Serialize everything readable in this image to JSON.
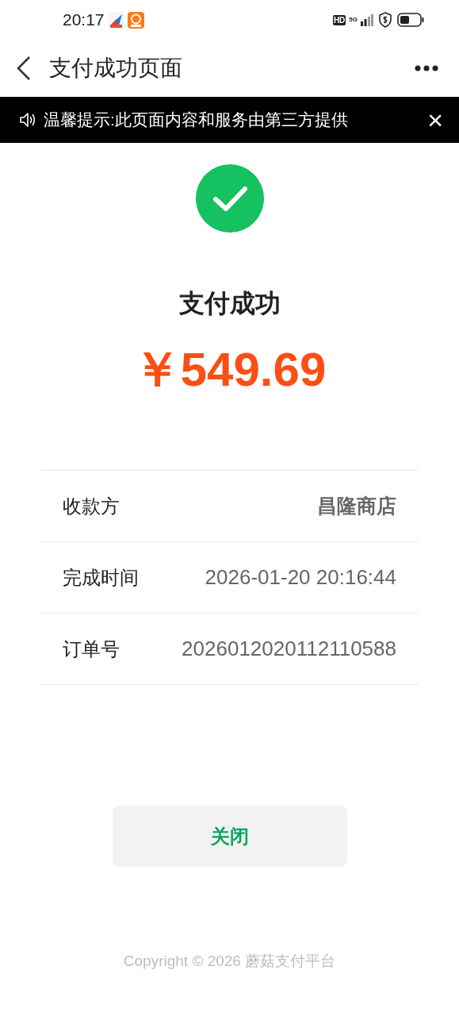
{
  "status_bar": {
    "time": "20:17",
    "network_badge": "HD",
    "network_type": "5G"
  },
  "nav": {
    "title": "支付成功页面"
  },
  "notice": {
    "text": "温馨提示:此页面内容和服务由第三方提供",
    "close": "×"
  },
  "result": {
    "title": "支付成功",
    "amount": "￥549.69"
  },
  "details": [
    {
      "label": "收款方",
      "value": "昌隆商店",
      "kind": "bold"
    },
    {
      "label": "完成时间",
      "value": "2026-01-20 20:16:44",
      "kind": "plain"
    },
    {
      "label": "订单号",
      "value": "2026012020112110588",
      "kind": "plain"
    }
  ],
  "close_button": "关闭",
  "footer": "Copyright © 2026 蘑菇支付平台"
}
